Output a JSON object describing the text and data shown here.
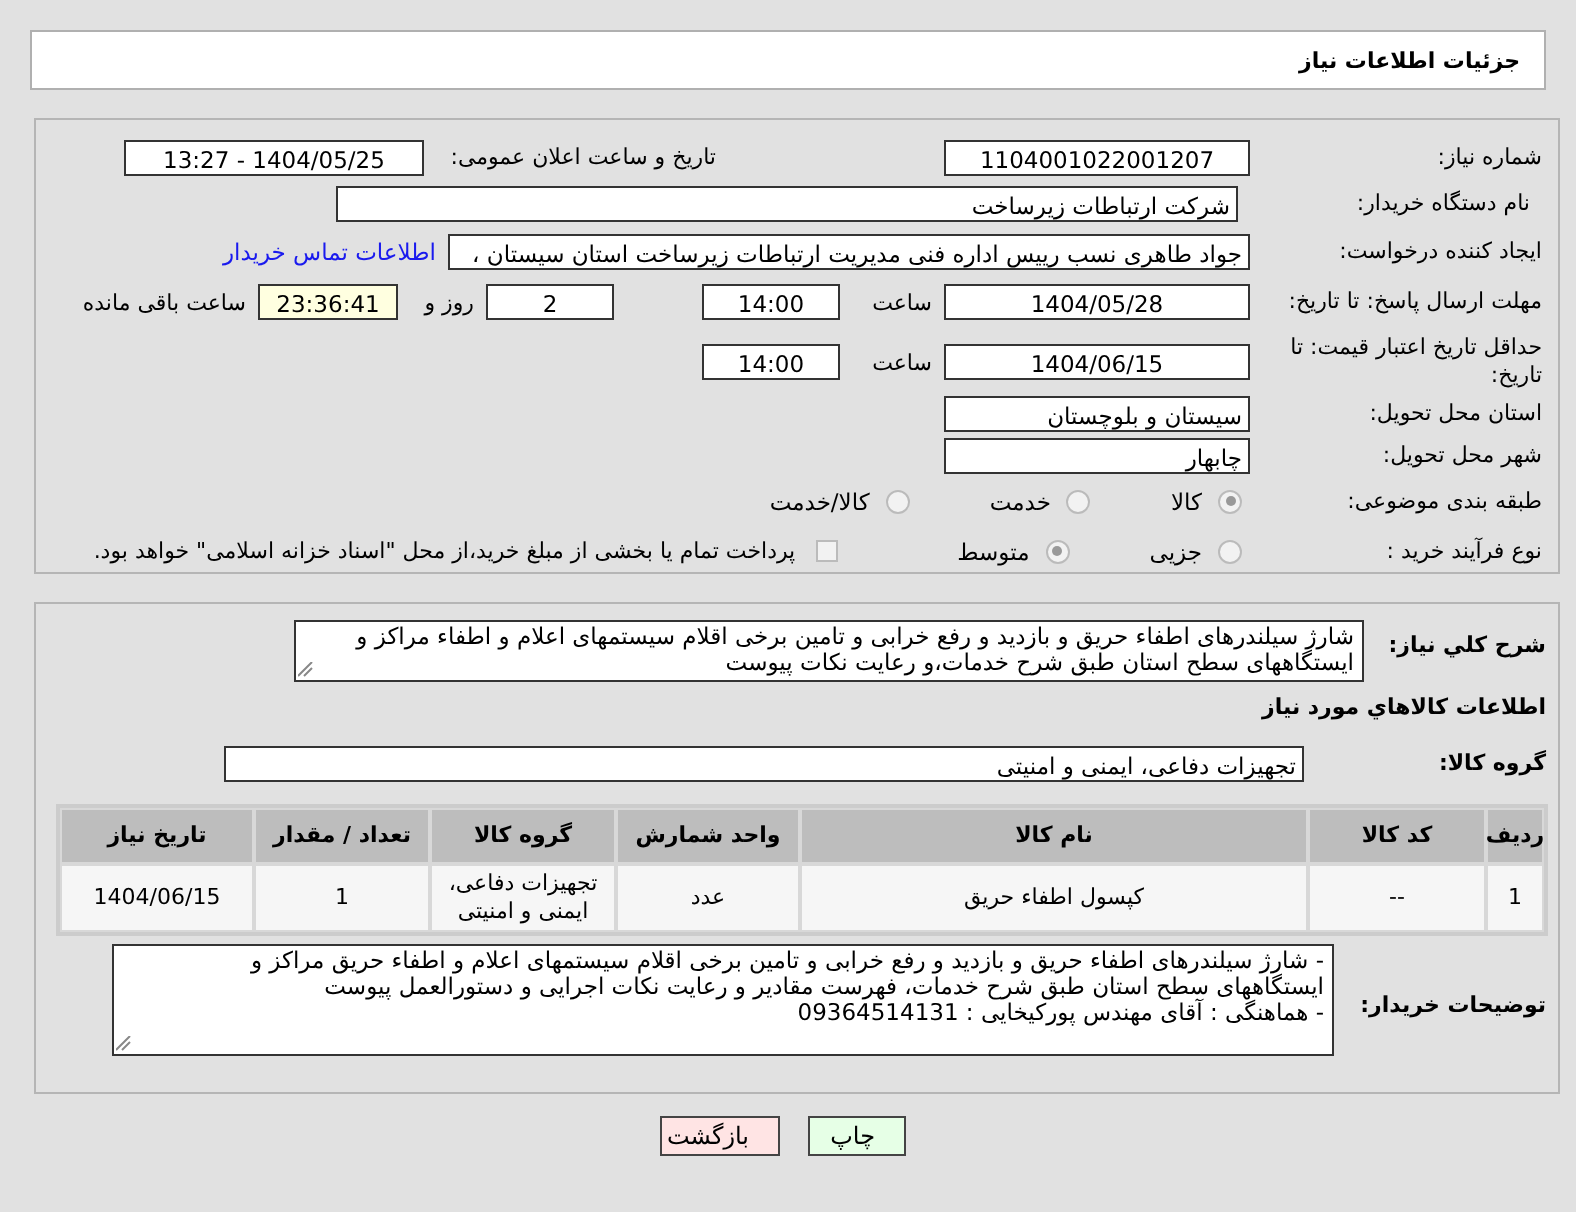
{
  "header": {
    "title": "جزئیات اطلاعات نیاز"
  },
  "need_number": {
    "label": "شماره نیاز:",
    "value": "1104001022001207"
  },
  "announce": {
    "label": "تاریخ و ساعت اعلان عمومی:",
    "value": "1404/05/25 - 13:27"
  },
  "buyer": {
    "label": "نام دستگاه خریدار:",
    "value": "شرکت ارتباطات زیرساخت"
  },
  "requester": {
    "label": "ایجاد کننده درخواست:",
    "value": "جواد طاهری نسب رییس اداره فنی مدیریت ارتباطات زیرساخت استان سیستان ،",
    "link": "اطلاعات تماس خریدار"
  },
  "deadline": {
    "label": "مهلت ارسال پاسخ: تا تاریخ:",
    "date": "1404/05/28",
    "time_label": "ساعت",
    "time": "14:00",
    "days": "2",
    "days_label": "روز و",
    "remaining": "23:36:41",
    "remaining_label": "ساعت باقی مانده"
  },
  "validity": {
    "label": "حداقل تاریخ اعتبار قیمت: تا تاریخ:",
    "date": "1404/06/15",
    "time_label": "ساعت",
    "time": "14:00"
  },
  "province": {
    "label": "استان محل تحویل:",
    "value": "سیستان و بلوچستان"
  },
  "city": {
    "label": "شهر محل تحویل:",
    "value": "چابهار"
  },
  "category": {
    "label": "طبقه بندی موضوعی:",
    "options": [
      {
        "label": "کالا",
        "selected": true
      },
      {
        "label": "خدمت",
        "selected": false
      },
      {
        "label": "کالا/خدمت",
        "selected": false
      }
    ]
  },
  "process": {
    "label": "نوع فرآیند خرید :",
    "options": [
      {
        "label": "جزیی",
        "selected": false
      },
      {
        "label": "متوسط",
        "selected": true
      }
    ],
    "payment": {
      "checked": false,
      "label": "پرداخت تمام یا بخشی از مبلغ خرید،از محل \"اسناد خزانه اسلامی\" خواهد بود."
    }
  },
  "description": {
    "label": "شرح کلي نياز:",
    "value": "شارژ سیلندرهای اطفاء حریق و بازدید و رفع خرابی و تامین برخی اقلام سیستمهای اعلام و اطفاء مراکز و ایستگاههای سطح استان طبق شرح خدمات،و رعایت نکات پیوست"
  },
  "goods_title": "اطلاعات کالاهاي مورد نياز",
  "group": {
    "label": "گروه کالا:",
    "value": "تجهیزات دفاعی، ایمنی و امنیتی"
  },
  "table": {
    "columns": [
      "ردیف",
      "کد کالا",
      "نام کالا",
      "واحد شمارش",
      "گروه کالا",
      "تعداد / مقدار",
      "تاریخ نیاز"
    ],
    "rows": [
      [
        "1",
        "--",
        "کپسول اطفاء حریق",
        "عدد",
        "تجهیزات دفاعی، ایمنی و امنیتی",
        "1",
        "1404/06/15"
      ]
    ]
  },
  "notes": {
    "label": "توضیحات خریدار:",
    "lines": [
      "- شارژ سیلندرهای اطفاء حریق و بازدید و رفع خرابی و تامین برخی اقلام سیستمهای اعلام و اطفاء حریق  مراکز و ایستگاههای سطح استان طبق شرح خدمات، فهرست مقادیر و رعایت نکات اجرایی و دستورالعمل پیوست",
      "- هماهنگی : آقای مهندس پورکیخایی : 09364514131"
    ]
  },
  "buttons": [
    {
      "label": "چاپ",
      "kind": "print"
    },
    {
      "label": "بازگشت",
      "kind": "back"
    }
  ]
}
